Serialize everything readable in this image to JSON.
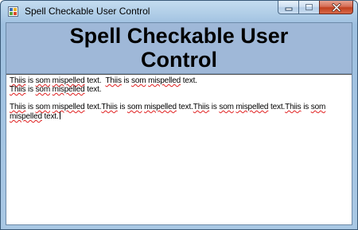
{
  "window": {
    "title": "Spell Checkable User Control",
    "icon": "window-app-icon",
    "buttons": {
      "minimize_icon": "minimize-icon",
      "maximize_icon": "maximize-icon",
      "close_icon": "close-icon"
    }
  },
  "header": {
    "line1": "Spell Checkable User",
    "line2": "Control"
  },
  "textbox": {
    "lines": [
      [
        "Thiis",
        " is ",
        "som",
        " mispelled text.  ",
        "Thiis",
        " is ",
        "som",
        " mispelled text."
      ],
      [
        "Thiis",
        " is ",
        "som",
        " mispelled text."
      ],
      [
        "Thiis",
        " is ",
        "som",
        " mispelled text.",
        "Thiis",
        " is ",
        "som",
        " mispelled text.",
        "Thiis",
        " is ",
        "som",
        " mispelled text.",
        "Thiis",
        " is ",
        "som",
        ""
      ],
      [
        "mispelled",
        " text."
      ]
    ],
    "misspelled_words": [
      "Thiis",
      "som",
      "mispelled"
    ],
    "underline_color": "#e02020"
  },
  "colors": {
    "header_bg": "#9fb8d8",
    "frame": "#a9c8e4",
    "close_button": "#c1401f"
  }
}
